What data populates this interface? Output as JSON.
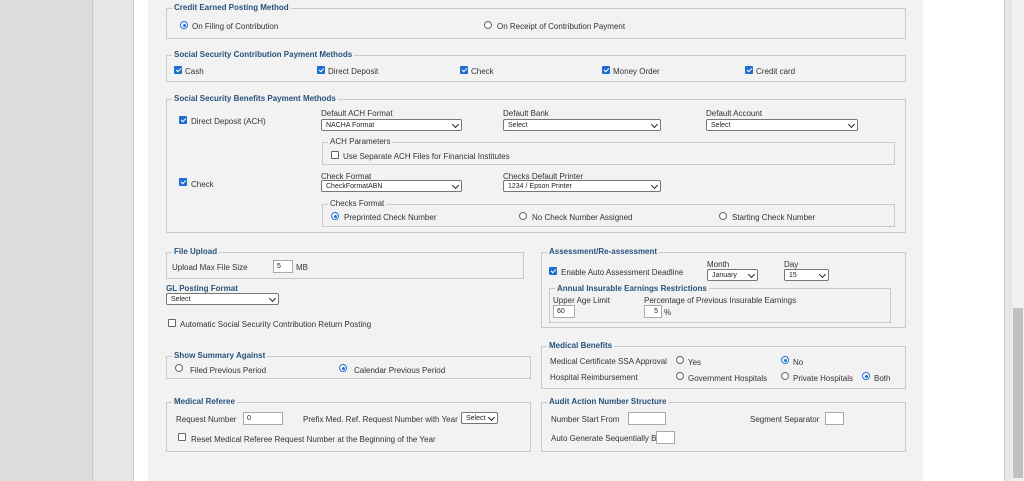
{
  "credit_posting": {
    "legend": "Credit Earned Posting Method",
    "options": [
      "On Filing of Contribution",
      "On Receipt of Contribution Payment"
    ],
    "selected_index": 0
  },
  "contribution_payment": {
    "legend": "Social Security Contribution Payment Methods",
    "methods": [
      {
        "label": "Cash",
        "checked": true
      },
      {
        "label": "Direct Deposit",
        "checked": true
      },
      {
        "label": "Check",
        "checked": true
      },
      {
        "label": "Money Order",
        "checked": true
      },
      {
        "label": "Credit card",
        "checked": true
      }
    ]
  },
  "benefits_payment": {
    "legend": "Social Security Benefits Payment Methods",
    "direct_deposit": {
      "label": "Direct Deposit (ACH)",
      "checked": true
    },
    "ach_format": {
      "label": "Default ACH Format",
      "value": "NACHA Format"
    },
    "bank": {
      "label": "Default Bank",
      "value": "Select"
    },
    "account": {
      "label": "Default Account",
      "value": "Select"
    },
    "ach_params": {
      "legend": "ACH Parameters",
      "separate_label": "Use Separate ACH Files for Financial Institutes",
      "checked": false
    },
    "check": {
      "label": "Check",
      "checked": true
    },
    "check_format": {
      "label": "Check Format",
      "value": "CheckFormatABN"
    },
    "printer": {
      "label": "Checks Default Printer",
      "value": "1234 / Epson Printer"
    },
    "checks_format": {
      "legend": "Checks Format",
      "options": [
        "Preprinted Check Number",
        "No Check Number Assigned",
        "Starting Check Number"
      ],
      "selected_index": 0
    }
  },
  "file_upload": {
    "legend": "File Upload",
    "label": "Upload Max File Size",
    "value": "5",
    "unit": "MB"
  },
  "gl_posting": {
    "legend": "GL Posting Format",
    "value": "Select"
  },
  "auto_return": {
    "label": "Automatic Social Security Contribution Return Posting",
    "checked": false
  },
  "assessment": {
    "legend": "Assessment/Re-assessment",
    "enable_label": "Enable Auto Assessment Deadline",
    "enable_checked": true,
    "month_label": "Month",
    "month_value": "January",
    "day_label": "Day",
    "day_value": "15",
    "insurable": {
      "legend": "Annual Insurable Earnings Restrictions",
      "age_label": "Upper Age Limit",
      "age_value": "60",
      "pct_label": "Percentage of Previous Insurable Earnings",
      "pct_value": "5",
      "pct_unit": "%"
    }
  },
  "summary": {
    "legend": "Show Summary Against",
    "options": [
      "Filed Previous Period",
      "Calendar Previous Period"
    ],
    "selected_index": 1
  },
  "medical_benefits": {
    "legend": "Medical Benefits",
    "cert_label": "Medical Certificate SSA Approval",
    "cert_options": [
      "Yes",
      "No"
    ],
    "cert_selected": 1,
    "reimb_label": "Hospital Reimbursement",
    "reimb_options": [
      "Government Hospitals",
      "Private Hospitals",
      "Both"
    ],
    "reimb_selected": 2
  },
  "medical_referee": {
    "legend": "Medical Referee",
    "request_label": "Request Number",
    "request_value": "0",
    "prefix_label": "Prefix Med. Ref. Request Number with Year",
    "prefix_value": "Select",
    "reset_label": "Reset Medical Referee Request Number at the Beginning of the Year",
    "reset_checked": false
  },
  "audit": {
    "legend": "Audit Action Number Structure",
    "start_label": "Number Start From",
    "start_value": "",
    "separator_label": "Segment Separator",
    "separator_value": "",
    "auto_label": "Auto Generate Sequentially By",
    "auto_value": ""
  },
  "colors": {
    "accent": "#1f6fd1",
    "legend": "#27527c",
    "background": "#f2f2f2"
  }
}
